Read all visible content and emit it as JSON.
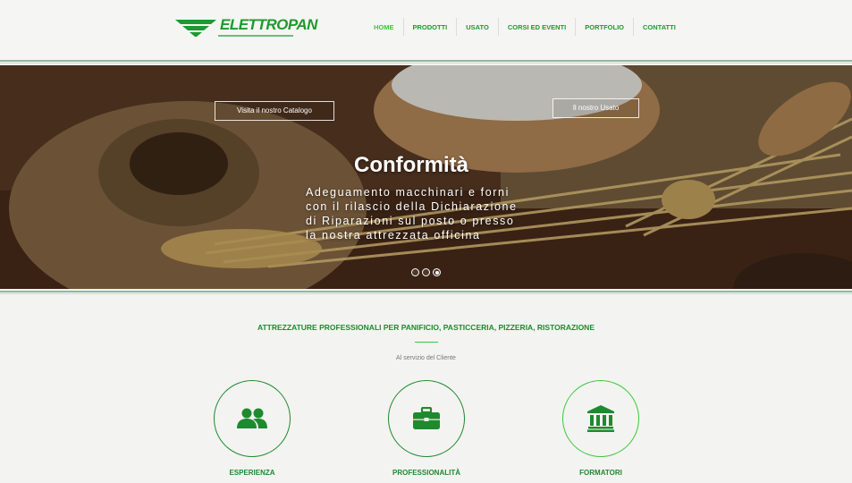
{
  "brand": {
    "name": "ELETTROPAN",
    "color": "#1e9a2e"
  },
  "nav": {
    "items": [
      {
        "label": "HOME",
        "active": true
      },
      {
        "label": "PRODOTTI",
        "active": false
      },
      {
        "label": "USATO",
        "active": false
      },
      {
        "label": "CORSI ED EVENTI",
        "active": false
      },
      {
        "label": "PORTFOLIO",
        "active": false
      },
      {
        "label": "CONTATTI",
        "active": false
      }
    ]
  },
  "hero": {
    "catalog_button": "Visita il nostro Catalogo",
    "usato_button": "Il nostro Usato",
    "title": "Conformità",
    "lines": [
      "Adeguamento macchinari e forni",
      "con il rilascio della Dichiarazione",
      "di Riparazioni sul posto o presso",
      "la nostra attrezzata officina"
    ],
    "slides": 3,
    "active_slide": 3
  },
  "section": {
    "title": "ATTREZZATURE PROFESSIONALI PER PANIFICIO, PASTICCERIA, PIZZERIA, RISTORAZIONE",
    "subtitle": "Al servizio del Cliente"
  },
  "features": [
    {
      "label": "ESPERIENZA",
      "icon": "users-icon"
    },
    {
      "label": "PROFESSIONALITÀ",
      "icon": "briefcase-icon"
    },
    {
      "label": "FORMATORI",
      "icon": "institution-icon"
    }
  ],
  "colors": {
    "accent": "#1e8a2e",
    "accent_light": "#3cc73c"
  }
}
